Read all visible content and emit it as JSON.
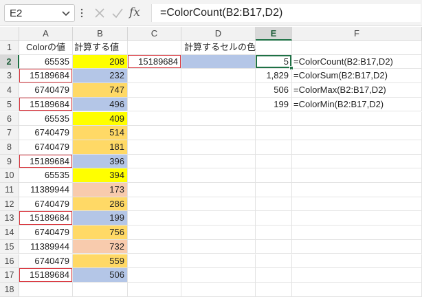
{
  "name_box": "E2",
  "formula_bar": "=ColorCount(B2:B17,D2)",
  "fx_label": "fx",
  "columns": [
    "A",
    "B",
    "C",
    "D",
    "E",
    "F"
  ],
  "selected_column": "E",
  "selected_row": "2",
  "colors": {
    "yellow": "#ffff00",
    "blue": "#b4c6e7",
    "orange": "#ffd966",
    "peach": "#f8cbad",
    "active_border": "#1e7145",
    "red_border": "#d9363e"
  },
  "rows": [
    {
      "num": "1",
      "a": "Colorの値",
      "b": "計算する値",
      "c": "",
      "d": "計算するセルの色",
      "e": "",
      "f": ""
    },
    {
      "num": "2",
      "a": "65535",
      "b": "208",
      "b_color": "yellow",
      "c": "15189684",
      "d": "",
      "d_color": "blue",
      "e": "5",
      "f": "=ColorCount(B2:B17,D2)"
    },
    {
      "num": "3",
      "a": "15189684",
      "b": "232",
      "b_color": "blue",
      "c": "",
      "d": "",
      "e": "1,829",
      "f": "=ColorSum(B2:B17,D2)"
    },
    {
      "num": "4",
      "a": "6740479",
      "b": "747",
      "b_color": "orange",
      "c": "",
      "d": "",
      "e": "506",
      "f": "=ColorMax(B2:B17,D2)"
    },
    {
      "num": "5",
      "a": "15189684",
      "b": "496",
      "b_color": "blue",
      "c": "",
      "d": "",
      "e": "199",
      "f": "=ColorMin(B2:B17,D2)"
    },
    {
      "num": "6",
      "a": "65535",
      "b": "409",
      "b_color": "yellow",
      "c": "",
      "d": "",
      "e": "",
      "f": ""
    },
    {
      "num": "7",
      "a": "6740479",
      "b": "514",
      "b_color": "orange",
      "c": "",
      "d": "",
      "e": "",
      "f": ""
    },
    {
      "num": "8",
      "a": "6740479",
      "b": "181",
      "b_color": "orange",
      "c": "",
      "d": "",
      "e": "",
      "f": ""
    },
    {
      "num": "9",
      "a": "15189684",
      "b": "396",
      "b_color": "blue",
      "c": "",
      "d": "",
      "e": "",
      "f": ""
    },
    {
      "num": "10",
      "a": "65535",
      "b": "394",
      "b_color": "yellow",
      "c": "",
      "d": "",
      "e": "",
      "f": ""
    },
    {
      "num": "11",
      "a": "11389944",
      "b": "173",
      "b_color": "peach",
      "c": "",
      "d": "",
      "e": "",
      "f": ""
    },
    {
      "num": "12",
      "a": "6740479",
      "b": "286",
      "b_color": "orange",
      "c": "",
      "d": "",
      "e": "",
      "f": ""
    },
    {
      "num": "13",
      "a": "15189684",
      "b": "199",
      "b_color": "blue",
      "c": "",
      "d": "",
      "e": "",
      "f": ""
    },
    {
      "num": "14",
      "a": "6740479",
      "b": "756",
      "b_color": "orange",
      "c": "",
      "d": "",
      "e": "",
      "f": ""
    },
    {
      "num": "15",
      "a": "11389944",
      "b": "732",
      "b_color": "peach",
      "c": "",
      "d": "",
      "e": "",
      "f": ""
    },
    {
      "num": "16",
      "a": "6740479",
      "b": "559",
      "b_color": "orange",
      "c": "",
      "d": "",
      "e": "",
      "f": ""
    },
    {
      "num": "17",
      "a": "15189684",
      "b": "506",
      "b_color": "blue",
      "c": "",
      "d": "",
      "e": "",
      "f": ""
    },
    {
      "num": "18",
      "a": "",
      "b": "",
      "c": "",
      "d": "",
      "e": "",
      "f": ""
    }
  ]
}
